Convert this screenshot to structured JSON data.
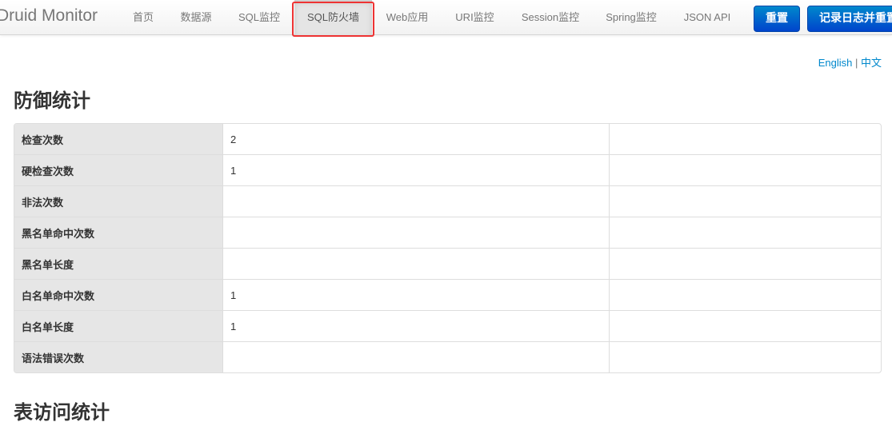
{
  "brand": "Druid Monitor",
  "nav": {
    "items": [
      "首页",
      "数据源",
      "SQL监控",
      "SQL防火墙",
      "Web应用",
      "URI监控",
      "Session监控",
      "Spring监控",
      "JSON API"
    ],
    "active": "SQL防火墙"
  },
  "buttons": {
    "reset": "重置",
    "log_and_reset": "记录日志并重置"
  },
  "lang": {
    "english": "English",
    "separator": "|",
    "chinese": "中文"
  },
  "sections": {
    "defense": "防御统计",
    "table_access": "表访问统计"
  },
  "stats": [
    {
      "label": "检查次数",
      "value": "2"
    },
    {
      "label": "硬检查次数",
      "value": "1"
    },
    {
      "label": "非法次数",
      "value": ""
    },
    {
      "label": "黑名单命中次数",
      "value": ""
    },
    {
      "label": "黑名单长度",
      "value": ""
    },
    {
      "label": "白名单命中次数",
      "value": "1"
    },
    {
      "label": "白名单长度",
      "value": "1"
    },
    {
      "label": "语法错误次数",
      "value": ""
    }
  ],
  "colors": {
    "primary_button": "#0055cc",
    "highlight_border": "#ee3333",
    "link": "#0088cc"
  }
}
